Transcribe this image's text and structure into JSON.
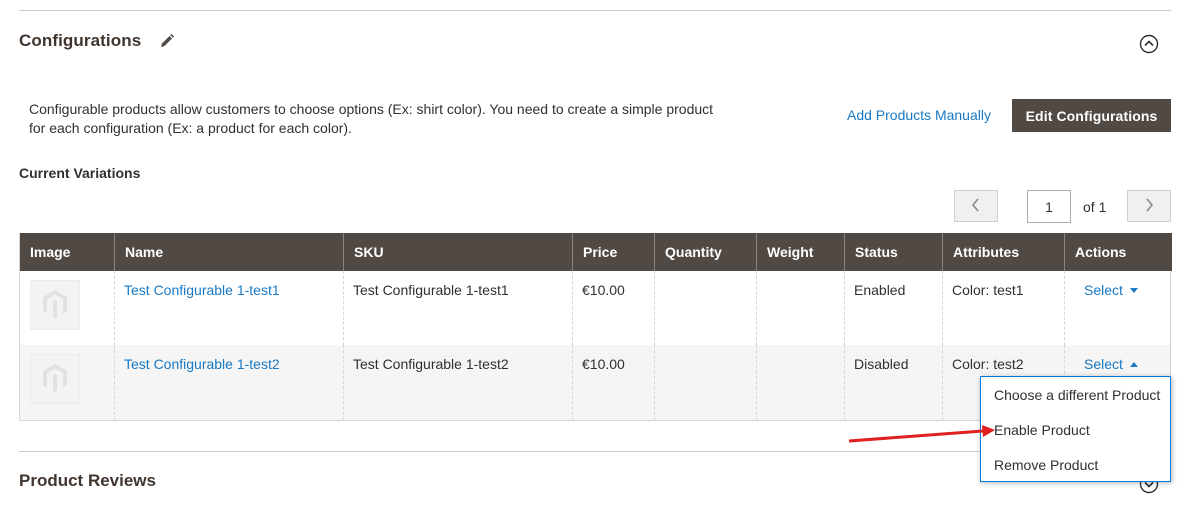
{
  "section": {
    "title": "Configurations",
    "description": "Configurable products allow customers to choose options (Ex: shirt color). You need to create a simple product for each configuration (Ex: a product for each color).",
    "add_products_manually": "Add Products Manually",
    "edit_configurations": "Edit Configurations"
  },
  "variations": {
    "heading": "Current Variations",
    "pager": {
      "page": "1",
      "of_label": "of 1"
    },
    "columns": [
      "Image",
      "Name",
      "SKU",
      "Price",
      "Quantity",
      "Weight",
      "Status",
      "Attributes",
      "Actions"
    ],
    "rows": [
      {
        "name": "Test Configurable 1-test1",
        "sku": "Test Configurable 1-test1",
        "price": "€10.00",
        "quantity": "",
        "weight": "",
        "status": "Enabled",
        "attributes": "Color: test1",
        "action": "Select"
      },
      {
        "name": "Test Configurable 1-test2",
        "sku": "Test Configurable 1-test2",
        "price": "€10.00",
        "quantity": "",
        "weight": "",
        "status": "Disabled",
        "attributes": "Color: test2",
        "action": "Select"
      }
    ],
    "action_menu": [
      "Choose a different Product",
      "Enable Product",
      "Remove Product"
    ]
  },
  "next_section": {
    "title": "Product Reviews"
  },
  "icons": {
    "edit": "pencil-icon",
    "collapse": "chevron-up-circle-icon",
    "prev": "chevron-left-icon",
    "next": "chevron-right-icon",
    "placeholder": "magento-logo-icon",
    "annotation": "red-arrow-annotation"
  },
  "colors": {
    "header_bg": "#514943",
    "link": "#1979c3",
    "menu_border": "#007bdb",
    "annotation": "#e02020"
  }
}
